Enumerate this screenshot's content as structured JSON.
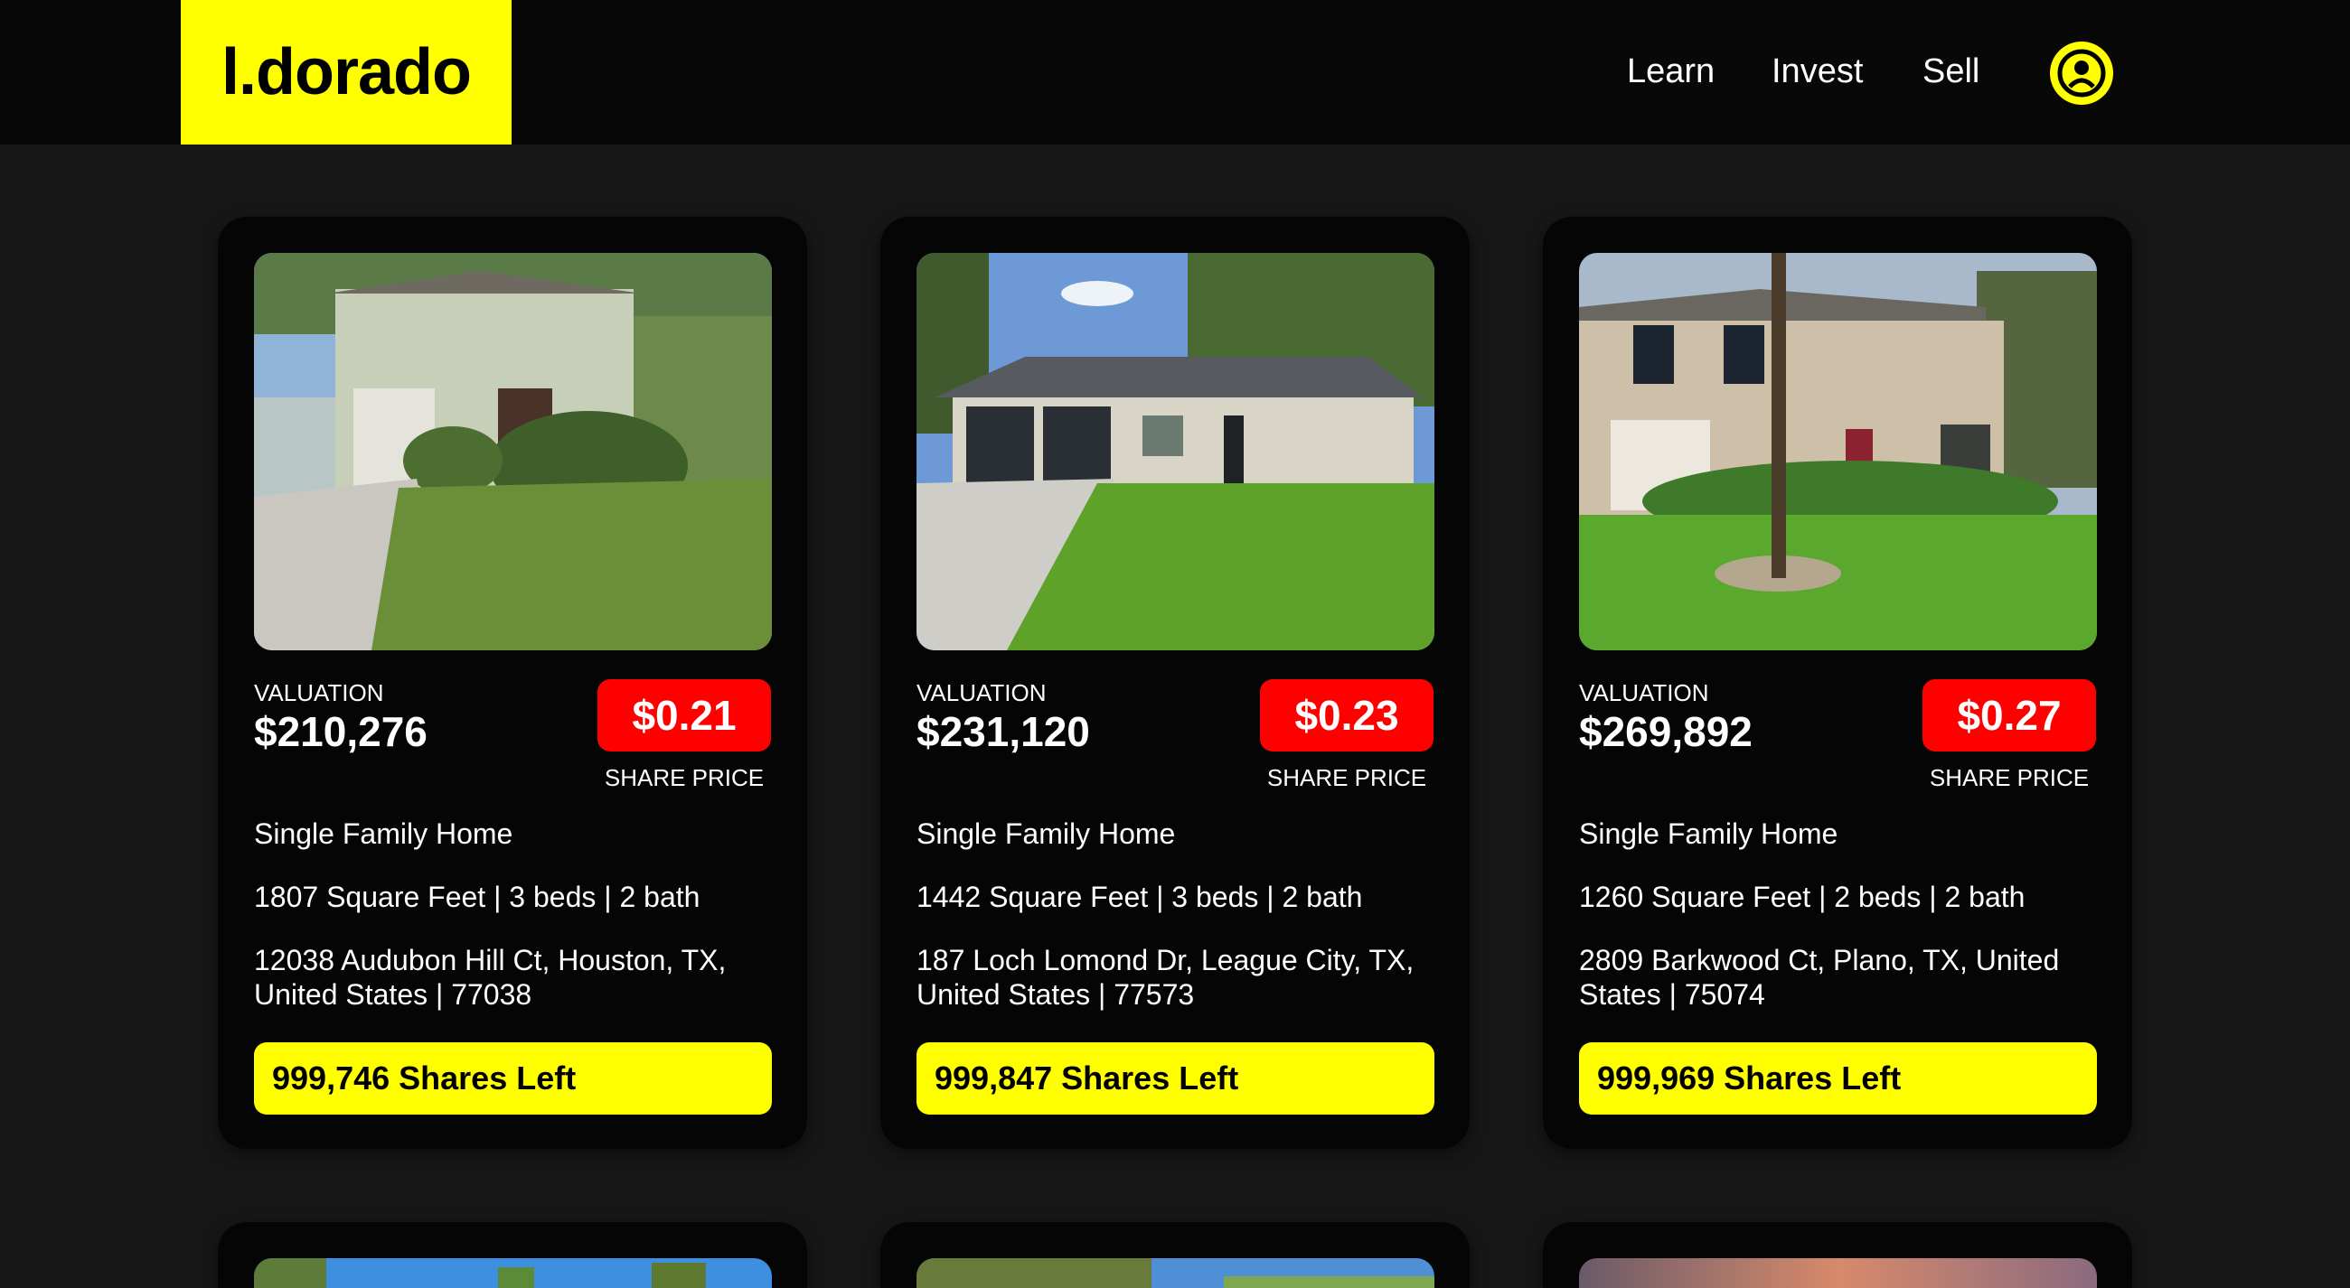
{
  "nav": {
    "logo": "l.dorado",
    "links": [
      "Learn",
      "Invest",
      "Sell"
    ],
    "account_icon": "user-circle-icon"
  },
  "colors": {
    "accent": "#ffff00",
    "price": "#ff0000",
    "background": "#171717",
    "card": "#050505"
  },
  "labels": {
    "valuation": "VALUATION",
    "share_price": "SHARE PRICE"
  },
  "properties": [
    {
      "valuation": "$210,276",
      "share_price": "$0.21",
      "type": "Single Family Home",
      "specs": "1807 Square Feet | 3 beds | 2 bath",
      "address": "12038 Audubon Hill Ct, Houston, TX, United States | 77038",
      "shares_left": "999,746 Shares Left"
    },
    {
      "valuation": "$231,120",
      "share_price": "$0.23",
      "type": "Single Family Home",
      "specs": "1442 Square Feet | 3 beds | 2 bath",
      "address": "187 Loch Lomond Dr, League City, TX, United States | 77573",
      "shares_left": "999,847 Shares Left"
    },
    {
      "valuation": "$269,892",
      "share_price": "$0.27",
      "type": "Single Family Home",
      "specs": "1260 Square Feet | 2 beds | 2 bath",
      "address": "2809 Barkwood Ct, Plano, TX, United States | 75074",
      "shares_left": "999,969 Shares Left"
    }
  ]
}
